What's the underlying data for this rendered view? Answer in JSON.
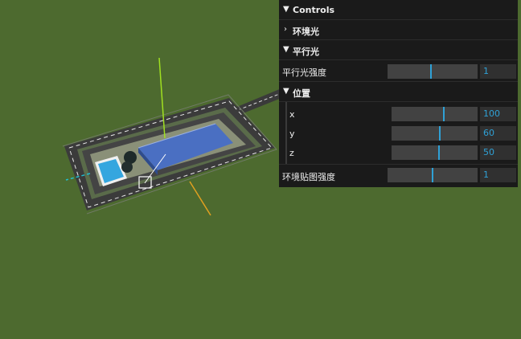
{
  "gui": {
    "title": "Controls",
    "folders": {
      "env_light": {
        "label": "环境光",
        "expanded": false
      },
      "dir_light": {
        "label": "平行光",
        "expanded": true,
        "intensity": {
          "label": "平行光强度",
          "value": "1",
          "fraction": 0.47
        },
        "position": {
          "label": "位置",
          "x": {
            "label": "x",
            "value": "100",
            "fraction": 0.6
          },
          "y": {
            "label": "y",
            "value": "60",
            "fraction": 0.55
          },
          "z": {
            "label": "z",
            "value": "50",
            "fraction": 0.54
          }
        }
      }
    },
    "env_map": {
      "label": "环境贴图强度",
      "value": "1",
      "fraction": 0.49
    }
  },
  "colors": {
    "background": "#4d6a2f",
    "panel": "#1a1a1a",
    "accent": "#2fa1d6",
    "y_axis": "#a0e020",
    "x_axis": "#e0a020",
    "z_axis": "#20c0d0"
  },
  "icons": {
    "folder_collapsed": "chevron-right-icon",
    "folder_expanded": "chevron-down-icon"
  }
}
